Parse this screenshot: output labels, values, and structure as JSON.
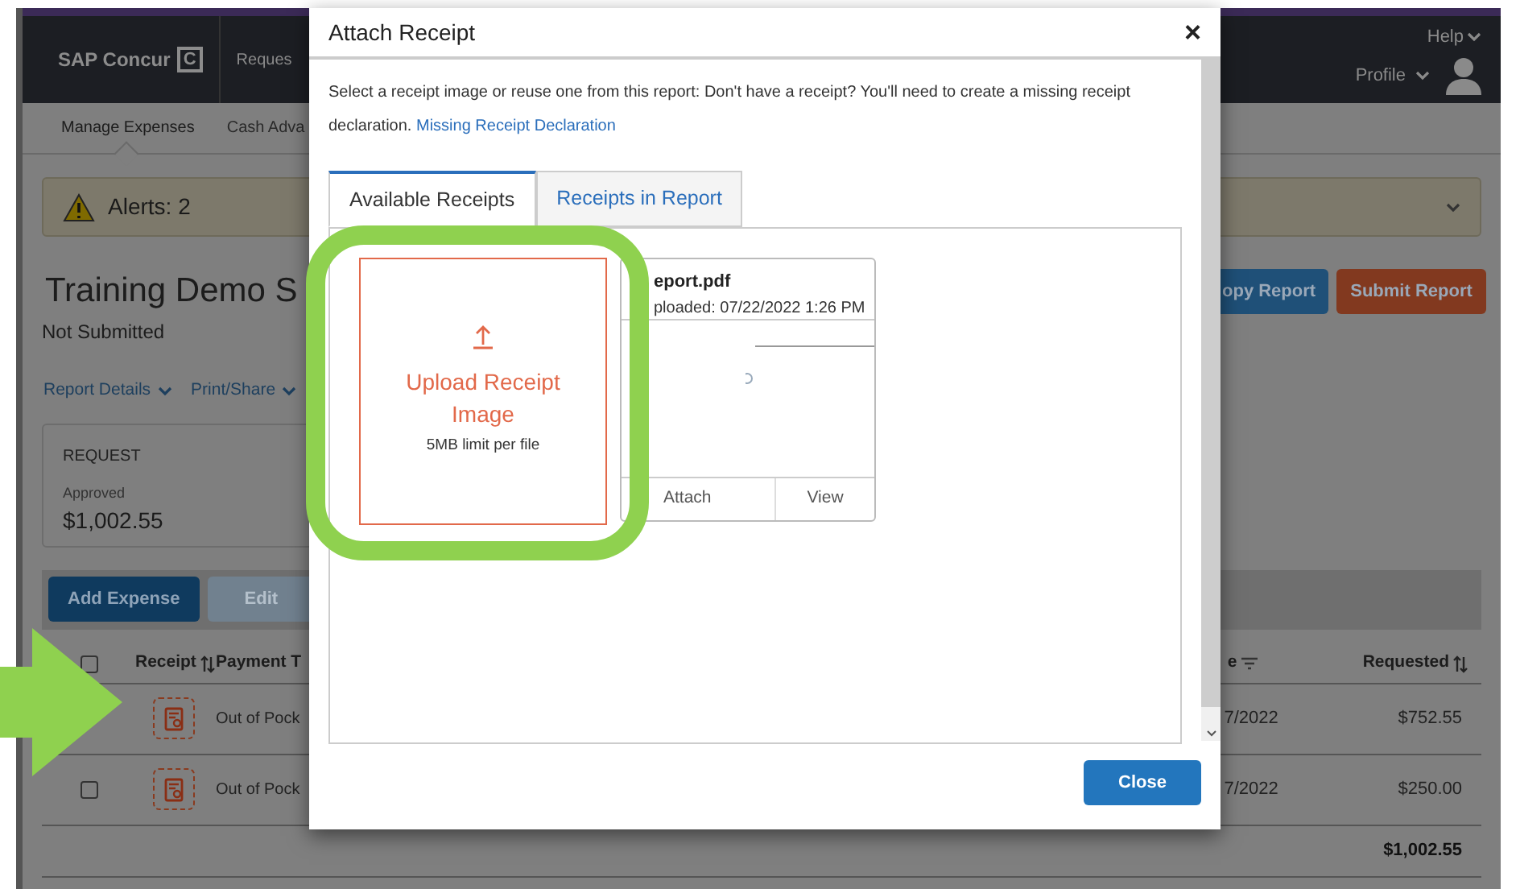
{
  "app_header": {
    "logo": "SAP Concur",
    "logo_mark": "C",
    "nav_item": "Reques",
    "help": "Help",
    "profile": "Profile"
  },
  "subnav": [
    {
      "label": "Manage Expenses",
      "selected": true
    },
    {
      "label": "Cash Adva",
      "selected": false
    }
  ],
  "alerts": {
    "label": "Alerts: 2"
  },
  "report": {
    "title": "Training Demo S",
    "status": "Not Submitted",
    "menus": [
      "Report Details",
      "Print/Share"
    ],
    "buttons": [
      {
        "label": "opy Report",
        "kind": "primary"
      },
      {
        "label": "Submit Report",
        "kind": "danger"
      }
    ]
  },
  "request_card": {
    "heading": "REQUEST",
    "status": "Approved",
    "amount": "$1,002.55"
  },
  "toolbar": [
    {
      "label": "Add Expense",
      "disabled": false
    },
    {
      "label": "Edit",
      "disabled": true
    }
  ],
  "table": {
    "select_all": {
      "checked": false
    },
    "columns": [
      {
        "label": "Receipt",
        "kind": "sort"
      },
      {
        "label": "Payment T",
        "kind": "plain"
      },
      {
        "label": "e",
        "kind": "filter"
      },
      {
        "label": "Requested",
        "kind": "sort"
      }
    ],
    "rows": [
      {
        "payment": "Out of Pock",
        "date": "7/2022",
        "amount": "$752.55"
      },
      {
        "checked": false,
        "payment": "Out of Pock",
        "date": "7/2022",
        "amount": "$250.00"
      }
    ],
    "total": "$1,002.55"
  },
  "dialog": {
    "title": "Attach Receipt",
    "close": "×",
    "intro": "Select a receipt image or reuse one from this report: Don't have a receipt? You'll need to create a missing receipt declaration.",
    "link": "Missing Receipt Declaration",
    "tabs": [
      {
        "label": "Available Receipts",
        "selected": true
      },
      {
        "label": "Receipts in Report",
        "selected": false
      }
    ],
    "upload": {
      "label": "Upload Receipt Image",
      "note": "5MB limit per file"
    },
    "receipt_card": {
      "file_name": "eport.pdf",
      "uploaded": "ploaded: 07/22/2022 1:26 PM",
      "actions": [
        "Attach",
        "View"
      ]
    },
    "close_button": "Close"
  }
}
